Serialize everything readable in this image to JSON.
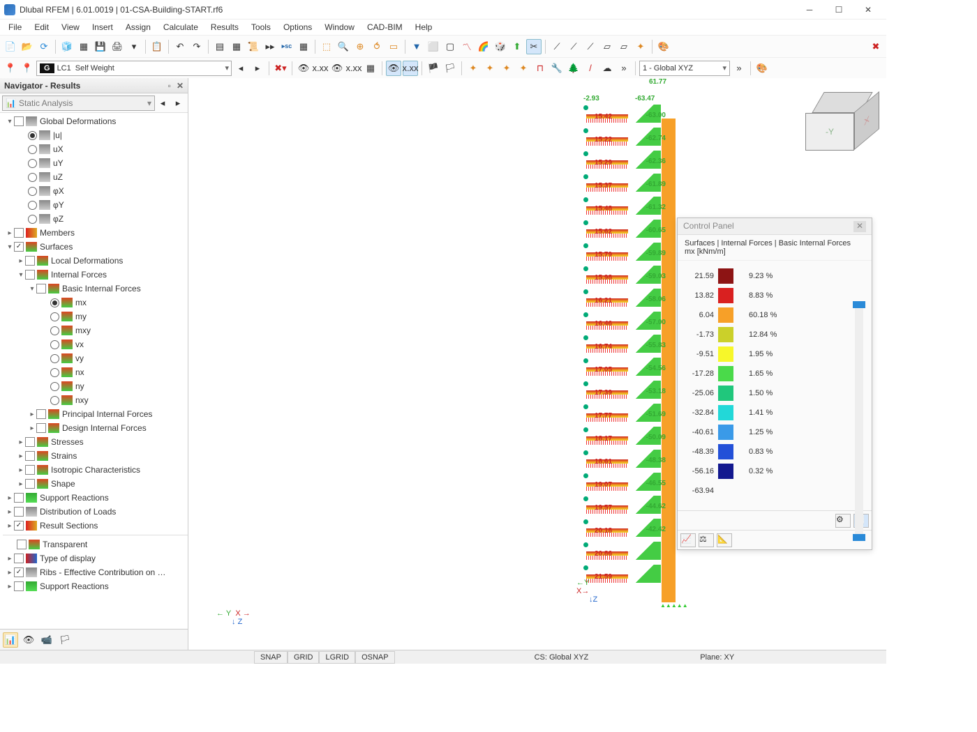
{
  "title": "Dlubal RFEM | 6.01.0019 | 01-CSA-Building-START.rf6",
  "menu": [
    "File",
    "Edit",
    "View",
    "Insert",
    "Assign",
    "Calculate",
    "Results",
    "Tools",
    "Options",
    "Window",
    "CAD-BIM",
    "Help"
  ],
  "loadcase": {
    "tag": "G",
    "num": "LC1",
    "name": "Self Weight"
  },
  "coordsys": "1 - Global XYZ",
  "nav": {
    "title": "Navigator - Results",
    "combo": "Static Analysis"
  },
  "tree": {
    "global_def": "Global Deformations",
    "u_items": [
      "|u|",
      "uX",
      "uY",
      "uZ",
      "φX",
      "φY",
      "φZ"
    ],
    "members": "Members",
    "surfaces": "Surfaces",
    "local_def": "Local Deformations",
    "internal": "Internal Forces",
    "basic": "Basic Internal Forces",
    "bif": [
      "mx",
      "my",
      "mxy",
      "vx",
      "vy",
      "nx",
      "ny",
      "nxy"
    ],
    "principal": "Principal Internal Forces",
    "design": "Design Internal Forces",
    "stresses": "Stresses",
    "strains": "Strains",
    "iso": "Isotropic Characteristics",
    "shape": "Shape",
    "support": "Support Reactions",
    "distrib": "Distribution of Loads",
    "rsections": "Result Sections",
    "transparent": "Transparent",
    "typeof": "Type of display",
    "ribs": "Ribs - Effective Contribution on …",
    "sreact2": "Support Reactions"
  },
  "topvals": {
    "a": "61.77",
    "b": "-2.93",
    "c": "-63.47"
  },
  "stories": [
    {
      "r": "15.42",
      "g": "-63.00"
    },
    {
      "r": "15.22",
      "g": "-62.74"
    },
    {
      "r": "15.29",
      "g": "-62.36"
    },
    {
      "r": "15.37",
      "g": "-61.89"
    },
    {
      "r": "15.48",
      "g": "-61.32"
    },
    {
      "r": "15.62",
      "g": "-60.65"
    },
    {
      "r": "15.79",
      "g": "-59.89"
    },
    {
      "r": "15.98",
      "g": "-59.03"
    },
    {
      "r": "16.21",
      "g": "-58.06"
    },
    {
      "r": "16.46",
      "g": "-57.00"
    },
    {
      "r": "16.74",
      "g": "-55.83"
    },
    {
      "r": "17.05",
      "g": "-54.56"
    },
    {
      "r": "17.39",
      "g": "-53.18"
    },
    {
      "r": "17.77",
      "g": "-51.69"
    },
    {
      "r": "18.17",
      "g": "-50.09"
    },
    {
      "r": "18.61",
      "g": "-48.38"
    },
    {
      "r": "19.07",
      "g": "-46.55"
    },
    {
      "r": "19.57",
      "g": "-44.62"
    },
    {
      "r": "20.18",
      "g": "-42.42"
    },
    {
      "r": "20.86",
      "g": ""
    },
    {
      "r": "21.59",
      "g": ""
    }
  ],
  "panel": {
    "title": "Control Panel",
    "sub1": "Surfaces | Internal Forces | Basic Internal Forces",
    "sub2": "mx [kNm/m]",
    "legend": [
      {
        "v": "21.59",
        "c": "#8d1414",
        "p": "9.23 %"
      },
      {
        "v": "13.82",
        "c": "#d92020",
        "p": "8.83 %"
      },
      {
        "v": "6.04",
        "c": "#f7a028",
        "p": "60.18 %"
      },
      {
        "v": "-1.73",
        "c": "#cbd02a",
        "p": "12.84 %"
      },
      {
        "v": "-9.51",
        "c": "#f7f72a",
        "p": "1.95 %"
      },
      {
        "v": "-17.28",
        "c": "#4ada4a",
        "p": "1.65 %"
      },
      {
        "v": "-25.06",
        "c": "#20c77c",
        "p": "1.50 %"
      },
      {
        "v": "-32.84",
        "c": "#22d8d8",
        "p": "1.41 %"
      },
      {
        "v": "-40.61",
        "c": "#3a9ae8",
        "p": "1.25 %"
      },
      {
        "v": "-48.39",
        "c": "#2350d8",
        "p": "0.83 %"
      },
      {
        "v": "-56.16",
        "c": "#12188f",
        "p": "0.32 %"
      },
      {
        "v": "-63.94",
        "c": "",
        "p": ""
      }
    ]
  },
  "status": {
    "snap": "SNAP",
    "grid": "GRID",
    "lgrid": "LGRID",
    "osnap": "OSNAP",
    "cs": "CS: Global XYZ",
    "plane": "Plane: XY"
  },
  "axes": {
    "x": "X",
    "y": "Y",
    "z": "Z"
  },
  "cube": {
    "front": "-Y",
    "side": "X"
  }
}
